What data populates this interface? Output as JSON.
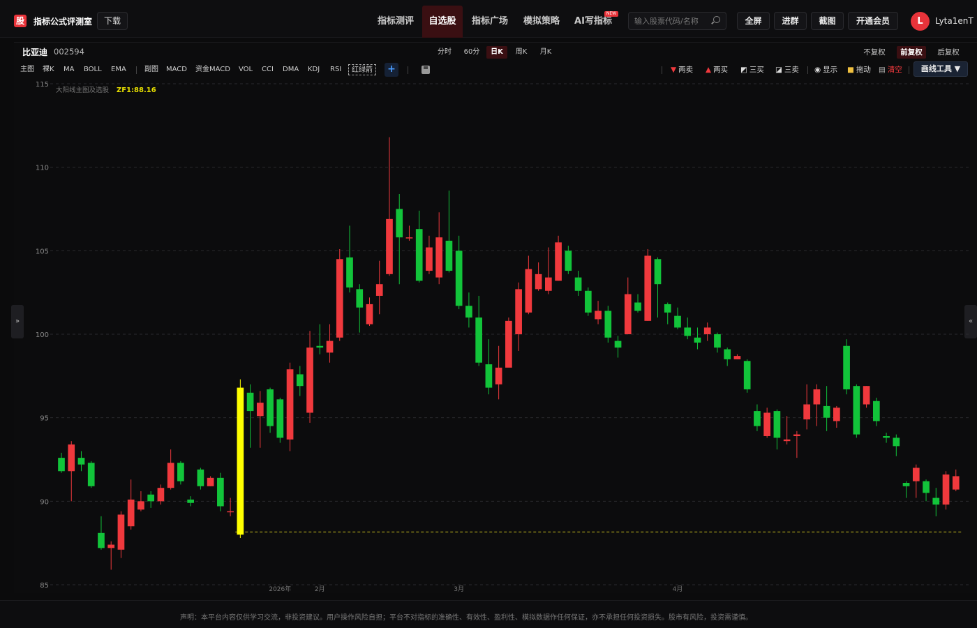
{
  "header": {
    "logo_char": "股",
    "app_title": "指标公式评测室",
    "download": "下载",
    "nav": [
      "指标测评",
      "自选股",
      "指标广场",
      "模拟策略",
      "AI写指标"
    ],
    "nav_active": 1,
    "new_badge": "NEW",
    "search_placeholder": "输入股票代码/名称",
    "fullscreen": "全屏",
    "join_group": "进群",
    "screenshot": "截图",
    "membership": "开通会员",
    "avatar_letter": "L",
    "username": "Lyta1enT"
  },
  "stock": {
    "name": "比亚迪",
    "code": "002594"
  },
  "periods": [
    "分时",
    "60分",
    "日K",
    "周K",
    "月K"
  ],
  "period_active": 2,
  "adjust": [
    "不复权",
    "前复权",
    "后复权"
  ],
  "adjust_active": 1,
  "indicators": {
    "main_label": "主图",
    "main": [
      "裸K",
      "MA",
      "BOLL",
      "EMA"
    ],
    "sub_label": "副图",
    "sub": [
      "MACD",
      "资金MACD",
      "VOL",
      "CCI",
      "DMA",
      "KDJ",
      "RSI"
    ],
    "custom": "红绿箭",
    "add": "+"
  },
  "tools": {
    "two_sell": "两卖",
    "two_buy": "两买",
    "three_buy": "三买",
    "three_sell": "三卖",
    "show": "显示",
    "drag": "拖动",
    "clear": "清空",
    "draw_tools": "画线工具 ▼"
  },
  "side_tabs": {
    "left": "»",
    "right": "«"
  },
  "colors": {
    "up": "#f0393d",
    "down": "#12c43a",
    "highlight": "#ffff00",
    "accent": "#e8333a",
    "info_value": "#e8e000"
  },
  "chart_data": {
    "type": "candlestick",
    "indicator_name": "大阳线主图及选股",
    "indicator_value": "ZF1:88.16",
    "reference_line": 88.16,
    "ylim": [
      85,
      115
    ],
    "yticks": [
      85,
      90,
      95,
      100,
      105,
      110,
      115
    ],
    "x_labels": [
      {
        "label": "2026年",
        "index": 22
      },
      {
        "label": "2月",
        "index": 26
      },
      {
        "label": "3月",
        "index": 40
      },
      {
        "label": "4月",
        "index": 62
      }
    ],
    "highlight_index": 16,
    "candles": [
      [
        92.6,
        91.8,
        92.9,
        91.7
      ],
      [
        91.8,
        93.4,
        93.6,
        90.0
      ],
      [
        92.6,
        92.2,
        93.0,
        91.8
      ],
      [
        92.3,
        90.9,
        92.4,
        90.8
      ],
      [
        88.1,
        87.2,
        89.1,
        87.1
      ],
      [
        87.2,
        87.4,
        87.6,
        85.9
      ],
      [
        87.1,
        89.2,
        89.4,
        86.6
      ],
      [
        88.5,
        90.1,
        91.3,
        88.3
      ],
      [
        89.5,
        90.0,
        90.6,
        89.4
      ],
      [
        90.4,
        90.0,
        90.6,
        89.6
      ],
      [
        90.0,
        90.8,
        91.0,
        89.8
      ],
      [
        90.8,
        92.3,
        93.1,
        90.7
      ],
      [
        92.3,
        91.2,
        92.4,
        91.0
      ],
      [
        90.1,
        89.9,
        90.3,
        89.7
      ],
      [
        91.9,
        90.9,
        92.0,
        90.7
      ],
      [
        90.9,
        91.4,
        91.5,
        90.9
      ],
      [
        91.4,
        89.7,
        91.7,
        89.4
      ],
      [
        89.4,
        89.4,
        90.2,
        89.1
      ],
      [
        88.0,
        96.8,
        97.3,
        87.8
      ],
      [
        96.5,
        95.4,
        97.0,
        93.2
      ],
      [
        95.1,
        95.9,
        96.6,
        93.2
      ],
      [
        96.7,
        94.5,
        96.8,
        94.1
      ],
      [
        96.1,
        93.8,
        96.2,
        93.5
      ],
      [
        93.7,
        97.9,
        98.3,
        93.0
      ],
      [
        97.6,
        96.9,
        98.1,
        96.3
      ],
      [
        95.3,
        99.2,
        100.2,
        94.7
      ],
      [
        99.3,
        99.2,
        100.6,
        98.8
      ],
      [
        98.9,
        99.6,
        100.6,
        98.3
      ],
      [
        99.8,
        104.5,
        105.1,
        99.6
      ],
      [
        104.6,
        102.8,
        106.5,
        102.5
      ],
      [
        102.7,
        101.6,
        103.0,
        100.1
      ],
      [
        100.6,
        101.8,
        102.2,
        100.5
      ],
      [
        102.3,
        103.0,
        104.4,
        101.2
      ],
      [
        103.6,
        106.9,
        111.8,
        103.5
      ],
      [
        107.5,
        105.8,
        108.4,
        103.0
      ],
      [
        105.8,
        105.8,
        106.5,
        105.6
      ],
      [
        106.3,
        103.2,
        107.4,
        103.1
      ],
      [
        103.8,
        105.2,
        105.9,
        103.6
      ],
      [
        103.4,
        105.8,
        107.3,
        103.0
      ],
      [
        105.6,
        103.8,
        108.6,
        103.7
      ],
      [
        105.0,
        101.7,
        105.9,
        101.5
      ],
      [
        101.7,
        101.0,
        102.5,
        100.4
      ],
      [
        101.0,
        98.3,
        102.3,
        98.1
      ],
      [
        98.2,
        96.8,
        99.7,
        96.4
      ],
      [
        97.0,
        98.0,
        99.3,
        96.1
      ],
      [
        98.0,
        100.8,
        101.0,
        98.6
      ],
      [
        100.0,
        102.7,
        103.1,
        99.0
      ],
      [
        101.3,
        103.9,
        104.7,
        101.2
      ],
      [
        102.7,
        103.6,
        104.3,
        102.6
      ],
      [
        102.6,
        103.4,
        105.2,
        102.4
      ],
      [
        103.2,
        105.5,
        105.9,
        103.2
      ],
      [
        105.0,
        103.8,
        105.3,
        103.6
      ],
      [
        103.4,
        102.6,
        103.8,
        102.3
      ],
      [
        102.6,
        101.3,
        102.8,
        101.1
      ],
      [
        100.9,
        101.4,
        102.0,
        100.6
      ],
      [
        101.4,
        99.8,
        101.7,
        99.5
      ],
      [
        99.6,
        99.2,
        99.9,
        98.6
      ],
      [
        100.0,
        102.4,
        103.4,
        100.0
      ],
      [
        101.9,
        101.4,
        102.4,
        101.3
      ],
      [
        100.8,
        104.7,
        105.1,
        100.8
      ],
      [
        104.5,
        103.0,
        104.6,
        101.0
      ],
      [
        101.8,
        101.3,
        101.9,
        100.6
      ],
      [
        101.1,
        100.4,
        101.6,
        100.3
      ],
      [
        100.4,
        99.9,
        101.0,
        99.7
      ],
      [
        99.8,
        99.5,
        100.4,
        99.1
      ],
      [
        100.0,
        100.4,
        100.7,
        99.6
      ],
      [
        100.0,
        99.2,
        100.1,
        98.9
      ],
      [
        99.1,
        98.5,
        99.2,
        98.1
      ],
      [
        98.5,
        98.7,
        98.8,
        98.5
      ],
      [
        98.4,
        96.7,
        98.5,
        96.5
      ],
      [
        95.4,
        94.5,
        95.8,
        94.2
      ],
      [
        93.9,
        95.3,
        95.6,
        93.8
      ],
      [
        95.4,
        93.8,
        95.5,
        93.1
      ],
      [
        93.6,
        93.7,
        95.1,
        93.4
      ],
      [
        93.9,
        94.0,
        94.2,
        92.6
      ],
      [
        94.9,
        95.8,
        97.0,
        94.3
      ],
      [
        95.8,
        96.7,
        97.0,
        94.5
      ],
      [
        95.7,
        95.0,
        96.9,
        94.2
      ],
      [
        94.8,
        95.6,
        95.7,
        94.4
      ],
      [
        99.3,
        96.7,
        99.7,
        96.4
      ],
      [
        96.9,
        94.0,
        97.0,
        93.8
      ],
      [
        95.8,
        96.9,
        96.9,
        95.6
      ],
      [
        96.0,
        94.8,
        96.2,
        94.5
      ],
      [
        93.9,
        93.8,
        94.1,
        93.5
      ],
      [
        93.8,
        93.3,
        94.0,
        92.7
      ],
      [
        91.1,
        90.9,
        91.2,
        90.2
      ],
      [
        91.2,
        92.0,
        92.2,
        90.2
      ],
      [
        91.2,
        90.5,
        91.3,
        90.0
      ],
      [
        90.2,
        89.8,
        90.8,
        89.1
      ],
      [
        89.8,
        91.6,
        91.8,
        89.5
      ],
      [
        90.7,
        91.5,
        91.9,
        90.6
      ]
    ]
  },
  "disclaimer": "声明：本平台内容仅供学习交流，非投资建议。用户操作风险自担；平台不对指标的准确性、有效性、盈利性、模拟数据作任何保证，亦不承担任何投资损失。股市有风险，投资需谨慎。"
}
